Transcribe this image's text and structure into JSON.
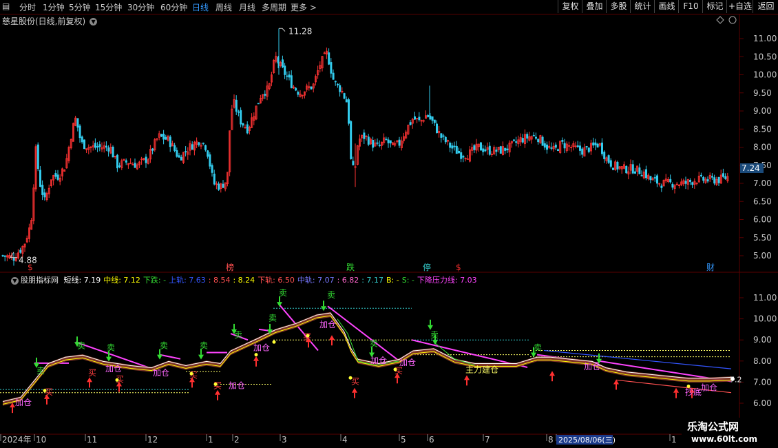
{
  "toolbar": {
    "periods": [
      "分时",
      "1分钟",
      "5分钟",
      "15分钟",
      "30分钟",
      "60分钟",
      "日线",
      "周线",
      "月线",
      "多周期",
      "更多 >"
    ],
    "active": "日线",
    "buttons": [
      "复权",
      "叠加",
      "多股",
      "统计",
      "画线",
      "F10",
      "标记",
      "+自选",
      "返回"
    ]
  },
  "main_panel": {
    "title": "慈星股份(日线,前复权)",
    "price_axis": [
      "11.00",
      "10.50",
      "10.00",
      "9.50",
      "9.00",
      "8.50",
      "8.00",
      "7.50",
      "7.00",
      "6.50",
      "6.00",
      "5.50",
      "5.00"
    ],
    "current_price": "7.24",
    "high_label": "11.28",
    "low_label": "4.88",
    "events": [
      {
        "text": "$",
        "color": "#ff3030"
      },
      {
        "text": "榜",
        "color": "#ff5050"
      },
      {
        "text": "跌",
        "color": "#33dd33"
      },
      {
        "text": "停",
        "color": "#33cccc"
      },
      {
        "text": "$",
        "color": "#ff3030"
      },
      {
        "text": "财",
        "color": "#3399ff"
      }
    ]
  },
  "sub_panel": {
    "title": "股朋指标网",
    "indicators": [
      {
        "label": "短线:",
        "value": "7.19",
        "color": "#ffffff"
      },
      {
        "label": "中线:",
        "value": "7.12",
        "color": "#ffff00"
      },
      {
        "label": "下跌:",
        "value": "-",
        "color": "#33dd33"
      },
      {
        "label": "上轨:",
        "value": "7.63",
        "color": "#3355ff"
      },
      {
        "label": ":",
        "value": "8.54",
        "color": "#ff5050"
      },
      {
        "label": ":",
        "value": "8.24",
        "color": "#ffff00"
      },
      {
        "label": "下轨:",
        "value": "6.50",
        "color": "#ff5050"
      },
      {
        "label": "中轨:",
        "value": "7.07",
        "color": "#7777ff"
      },
      {
        "label": ":",
        "value": "6.82",
        "color": "#ff66cc"
      },
      {
        "label": ":",
        "value": "7.17",
        "color": "#33cccc"
      },
      {
        "label": "B:",
        "value": "-",
        "color": "#ffff00"
      },
      {
        "label": "S:",
        "value": "-",
        "color": "#33dd33"
      },
      {
        "label": "下降压力线:",
        "value": "7.03",
        "color": "#ff44ff"
      }
    ],
    "price_axis": [
      "11.00",
      "10.00",
      "9.00",
      "8.00",
      "7.00",
      "6.00"
    ],
    "right_value": "7.2",
    "markers": [
      {
        "text": "加仓",
        "color": "#ff66ff"
      },
      {
        "text": "买",
        "color": "#ff4040"
      },
      {
        "text": "卖",
        "color": "#33dd33"
      },
      {
        "text": "主力建仓",
        "color": "#ffff66"
      },
      {
        "text": "抄底",
        "color": "#ff66ff"
      }
    ]
  },
  "time_axis": [
    "2024年",
    "10",
    "11",
    "12",
    "1",
    "2",
    "3",
    "4",
    "5",
    "6",
    "7",
    "8",
    "2025/08/06(三)",
    "1"
  ],
  "watermark": {
    "line1": "乐淘公式网",
    "line2": "www.60lt.com"
  },
  "colors": {
    "up": "#ff3333",
    "down": "#33ccee",
    "frame": "#5a0000",
    "axis_text": "#c8c8c8"
  }
}
